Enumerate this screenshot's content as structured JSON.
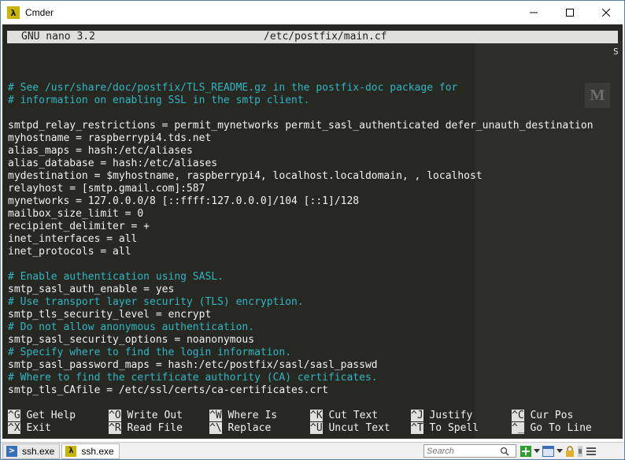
{
  "window": {
    "app_icon_glyph": "λ",
    "title": "Cmder"
  },
  "nano": {
    "version": "GNU nano 3.2",
    "filename": "/etc/postfix/main.cf",
    "side_indicator": "S"
  },
  "editor": {
    "lines": [
      {
        "text": "",
        "type": "blank"
      },
      {
        "text": "# See /usr/share/doc/postfix/TLS_README.gz in the postfix-doc package for",
        "type": "comment"
      },
      {
        "text": "# information on enabling SSL in the smtp client.",
        "type": "comment"
      },
      {
        "text": "",
        "type": "blank"
      },
      {
        "text": "smtpd_relay_restrictions = permit_mynetworks permit_sasl_authenticated defer_unauth_destination",
        "type": "code"
      },
      {
        "text": "myhostname = raspberrypi4.tds.net",
        "type": "code"
      },
      {
        "text": "alias_maps = hash:/etc/aliases",
        "type": "code"
      },
      {
        "text": "alias_database = hash:/etc/aliases",
        "type": "code"
      },
      {
        "text": "mydestination = $myhostname, raspberrypi4, localhost.localdomain, , localhost",
        "type": "code"
      },
      {
        "text": "relayhost = [smtp.gmail.com]:587",
        "type": "code"
      },
      {
        "text": "mynetworks = 127.0.0.0/8 [::ffff:127.0.0.0]/104 [::1]/128",
        "type": "code"
      },
      {
        "text": "mailbox_size_limit = 0",
        "type": "code"
      },
      {
        "text": "recipient_delimiter = +",
        "type": "code"
      },
      {
        "text": "inet_interfaces = all",
        "type": "code"
      },
      {
        "text": "inet_protocols = all",
        "type": "code"
      },
      {
        "text": "",
        "type": "blank"
      },
      {
        "text": "# Enable authentication using SASL.",
        "type": "comment"
      },
      {
        "text": "smtp_sasl_auth_enable = yes",
        "type": "code"
      },
      {
        "text": "# Use transport layer security (TLS) encryption.",
        "type": "comment"
      },
      {
        "text": "smtp_tls_security_level = encrypt",
        "type": "code"
      },
      {
        "text": "# Do not allow anonymous authentication.",
        "type": "comment"
      },
      {
        "text": "smtp_sasl_security_options = noanonymous",
        "type": "code"
      },
      {
        "text": "# Specify where to find the login information.",
        "type": "comment"
      },
      {
        "text": "smtp_sasl_password_maps = hash:/etc/postfix/sasl/sasl_passwd",
        "type": "code"
      },
      {
        "text": "# Where to find the certificate authority (CA) certificates.",
        "type": "comment"
      },
      {
        "text": "smtp_tls_CAfile = /etc/ssl/certs/ca-certificates.crt",
        "type": "code"
      }
    ]
  },
  "shortcuts": [
    {
      "key": "^G",
      "label": "Get Help"
    },
    {
      "key": "^O",
      "label": "Write Out"
    },
    {
      "key": "^W",
      "label": "Where Is"
    },
    {
      "key": "^K",
      "label": "Cut Text"
    },
    {
      "key": "^J",
      "label": "Justify"
    },
    {
      "key": "^C",
      "label": "Cur Pos"
    },
    {
      "key": "^X",
      "label": "Exit"
    },
    {
      "key": "^R",
      "label": "Read File"
    },
    {
      "key": "^\\",
      "label": "Replace"
    },
    {
      "key": "^U",
      "label": "Uncut Text"
    },
    {
      "key": "^T",
      "label": "To Spell"
    },
    {
      "key": "^_",
      "label": "Go To Line"
    }
  ],
  "taskbar": {
    "tasks": [
      {
        "label": "ssh.exe",
        "icon": "console-icon"
      },
      {
        "label": "ssh.exe",
        "icon": "lambda-icon",
        "icon_glyph": "λ"
      }
    ],
    "search_placeholder": "Search"
  },
  "colors": {
    "terminal_bg": "#272822",
    "comment": "#2fb6c4",
    "text": "#f2f2f2",
    "header_bg": "#e0e0dc"
  }
}
